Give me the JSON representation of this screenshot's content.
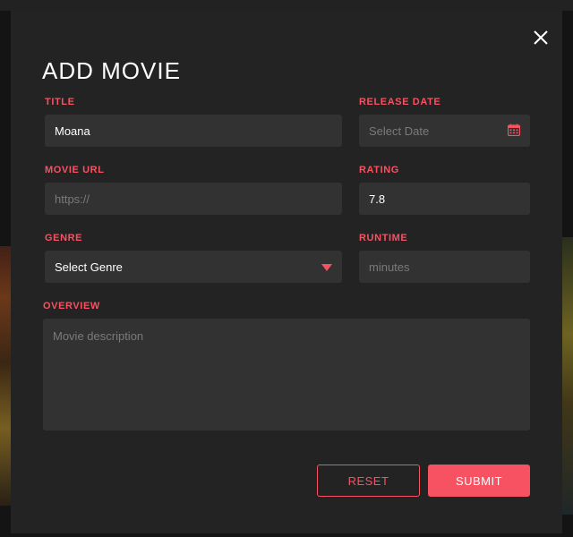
{
  "modal": {
    "title": "ADD MOVIE",
    "accent_color": "#f65261",
    "background_color": "#232323",
    "field_color": "#323232"
  },
  "fields": {
    "title": {
      "label": "TITLE",
      "value": "Moana"
    },
    "release_date": {
      "label": "RELEASE DATE",
      "placeholder": "Select Date",
      "icon": "calendar-icon"
    },
    "movie_url": {
      "label": "MOVIE URL",
      "placeholder": "https://"
    },
    "rating": {
      "label": "RATING",
      "value": "7.8"
    },
    "genre": {
      "label": "GENRE",
      "selected": "Select Genre",
      "icon": "caret-down-icon"
    },
    "runtime": {
      "label": "RUNTIME",
      "placeholder": "minutes"
    },
    "overview": {
      "label": "OVERVIEW",
      "placeholder": "Movie description"
    }
  },
  "actions": {
    "reset_label": "RESET",
    "submit_label": "SUBMIT"
  },
  "icons": {
    "close": "close-icon"
  }
}
